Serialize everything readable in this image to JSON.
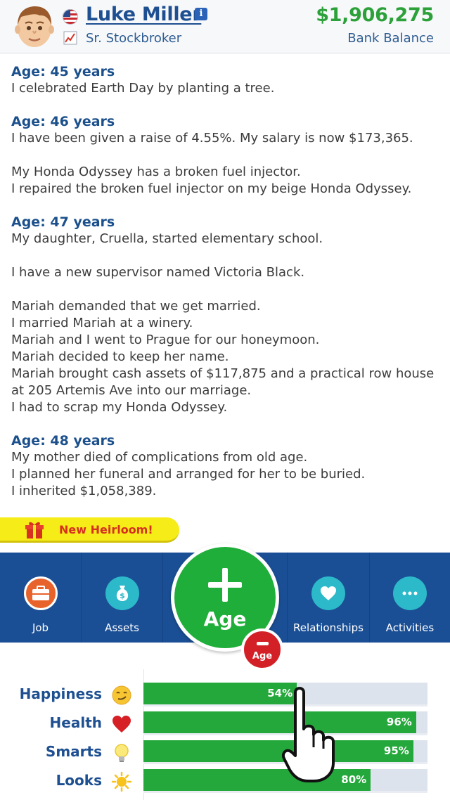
{
  "header": {
    "name": "Luke Miller",
    "job_title": "Sr. Stockbroker",
    "balance": "$1,906,275",
    "balance_label": "Bank Balance",
    "icons": {
      "flag": "us-flag-icon",
      "info": "info-icon",
      "job": "stock-chart-icon",
      "avatar": "male-avatar"
    },
    "info_glyph": "i"
  },
  "feed": [
    {
      "age": "Age: 45 years",
      "blocks": [
        [
          "I celebrated Earth Day by planting a tree."
        ]
      ]
    },
    {
      "age": "Age: 46 years",
      "blocks": [
        [
          "I have been given a raise of 4.55%. My salary is now $173,365."
        ],
        [
          "My Honda Odyssey has a broken fuel injector.",
          "I repaired the broken fuel injector on my beige Honda Odyssey."
        ]
      ]
    },
    {
      "age": "Age: 47 years",
      "blocks": [
        [
          "My daughter, Cruella, started elementary school."
        ],
        [
          "I have a new supervisor named Victoria Black."
        ],
        [
          "Mariah demanded that we get married.",
          "I married Mariah at a winery.",
          "Mariah and I went to Prague for our honeymoon.",
          "Mariah decided to keep her name.",
          "Mariah brought cash assets of $117,875 and a practical row house at 205 Artemis Ave into our marriage.",
          "I had to scrap my Honda Odyssey."
        ]
      ]
    },
    {
      "age": "Age: 48 years",
      "blocks": [
        [
          "My mother died of complications from old age.",
          "I planned her funeral and arranged for her to be buried.",
          "I inherited $1,058,389."
        ]
      ]
    }
  ],
  "heirloom": {
    "label": "New Heirloom!",
    "icon": "gift-icon"
  },
  "nav": {
    "job": {
      "label": "Job",
      "icon": "briefcase-icon",
      "color": "#e8632b"
    },
    "assets": {
      "label": "Assets",
      "icon": "money-bag-icon",
      "color": "#2cb9c9"
    },
    "age": {
      "label": "Age",
      "icon": "plus-icon",
      "color": "#1fae3a"
    },
    "age_minus": {
      "label": "Age",
      "icon": "minus-icon",
      "color": "#d32027"
    },
    "relationships": {
      "label": "Relationships",
      "icon": "heart-icon",
      "color": "#2cb9c9"
    },
    "activities": {
      "label": "Activities",
      "icon": "more-dots-icon",
      "color": "#2cb9c9"
    }
  },
  "stats": [
    {
      "label": "Happiness",
      "value": 54,
      "display": "54%",
      "icon": "smirk-face-icon"
    },
    {
      "label": "Health",
      "value": 96,
      "display": "96%",
      "icon": "heart-icon"
    },
    {
      "label": "Smarts",
      "value": 95,
      "display": "95%",
      "icon": "lightbulb-icon"
    },
    {
      "label": "Looks",
      "value": 80,
      "display": "80%",
      "icon": "sun-icon"
    }
  ],
  "overlay": {
    "icon": "pointing-hand-icon"
  },
  "colors": {
    "brand_blue": "#1b4f95",
    "money_green": "#2ca13a",
    "bar_green": "#25a83b",
    "banner_yellow": "#f6ec17"
  }
}
